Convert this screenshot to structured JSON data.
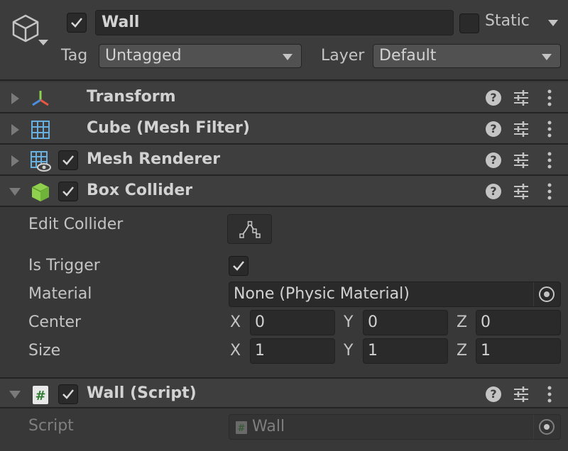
{
  "gameobject": {
    "name": "Wall",
    "active": true,
    "static_label": "Static",
    "static": false,
    "tag_label": "Tag",
    "tag_value": "Untagged",
    "layer_label": "Layer",
    "layer_value": "Default"
  },
  "components": [
    {
      "title": "Transform",
      "expanded": false,
      "icon": "transform-icon",
      "has_toggle": false
    },
    {
      "title": "Cube (Mesh Filter)",
      "expanded": false,
      "icon": "mesh-filter-icon",
      "has_toggle": false
    },
    {
      "title": "Mesh Renderer",
      "expanded": false,
      "icon": "mesh-renderer-icon",
      "has_toggle": true,
      "enabled": true
    },
    {
      "title": "Box Collider",
      "expanded": true,
      "icon": "box-collider-icon",
      "has_toggle": true,
      "enabled": true
    },
    {
      "title": "Wall (Script)",
      "expanded": true,
      "icon": "script-icon",
      "has_toggle": true,
      "enabled": true
    }
  ],
  "box_collider": {
    "edit_collider_label": "Edit Collider",
    "is_trigger_label": "Is Trigger",
    "is_trigger": true,
    "material_label": "Material",
    "material_value": "None (Physic Material)",
    "center_label": "Center",
    "center": {
      "x_label": "X",
      "x": "0",
      "y_label": "Y",
      "y": "0",
      "z_label": "Z",
      "z": "0"
    },
    "size_label": "Size",
    "size": {
      "x_label": "X",
      "x": "1",
      "y_label": "Y",
      "y": "1",
      "z_label": "Z",
      "z": "1"
    }
  },
  "wall_script": {
    "script_label": "Script",
    "script_value": "Wall"
  },
  "colors": {
    "background": "#383838",
    "header": "#3c3c3c",
    "component_header": "#3e3e3e",
    "field": "#2a2a2a",
    "text": "#c4c4c4",
    "mesh_filter_icon": "#6ab0de",
    "box_collider_icon": "#8fd14f",
    "script_icon": "#2e7d32"
  }
}
